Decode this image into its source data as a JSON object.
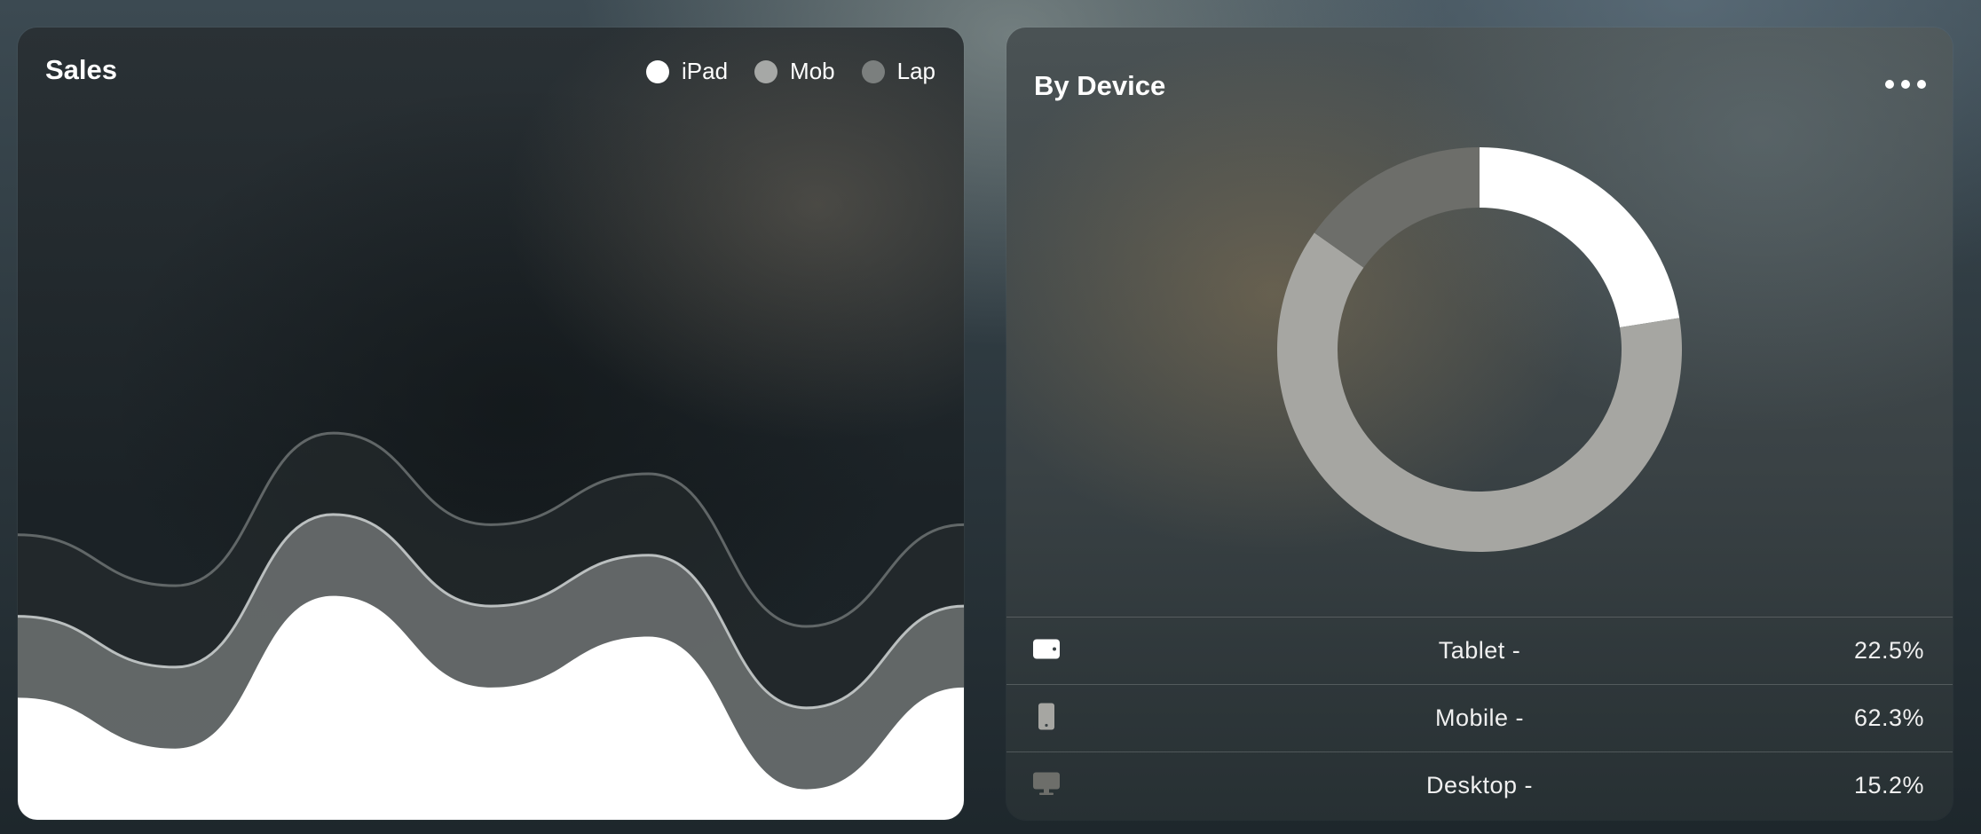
{
  "sales": {
    "title": "Sales",
    "legend": [
      {
        "label": "iPad",
        "color": "#ffffff"
      },
      {
        "label": "Mob",
        "color": "#a6a8a6"
      },
      {
        "label": "Lap",
        "color": "#7b7f7e"
      }
    ]
  },
  "device": {
    "title": "By Device",
    "menu_icon": "more-horizontal-icon",
    "rows": [
      {
        "icon": "tablet-icon",
        "label": "Tablet -",
        "value": "22.5%",
        "color": "#ffffff"
      },
      {
        "icon": "mobile-icon",
        "label": "Mobile -",
        "value": "62.3%",
        "color": "#a6a6a2"
      },
      {
        "icon": "desktop-icon",
        "label": "Desktop -",
        "value": "15.2%",
        "color": "#6d6e6a"
      }
    ]
  },
  "chart_data": [
    {
      "type": "area",
      "title": "Sales",
      "x": [
        0,
        1,
        2,
        3,
        4,
        5,
        6
      ],
      "series": [
        {
          "name": "iPad",
          "values": [
            6,
            3.5,
            11,
            6.5,
            9,
            1.5,
            6.5
          ]
        },
        {
          "name": "Mob",
          "values": [
            4,
            4,
            4,
            4,
            4,
            4,
            4
          ]
        },
        {
          "name": "Lap",
          "values": [
            4,
            4,
            4,
            4,
            4,
            4,
            4
          ]
        }
      ],
      "legend": "top-right",
      "grid": false
    },
    {
      "type": "pie",
      "title": "By Device",
      "categories": [
        "Tablet",
        "Mobile",
        "Desktop"
      ],
      "values": [
        22.5,
        62.3,
        15.2
      ]
    }
  ]
}
